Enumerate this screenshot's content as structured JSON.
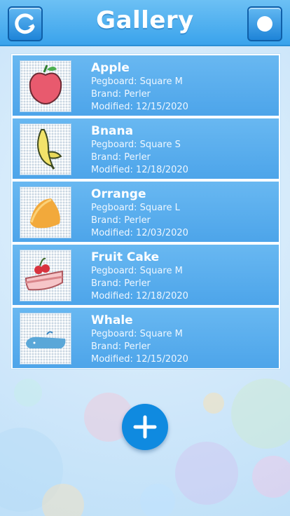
{
  "header": {
    "title": "Gallery",
    "left_icon": "refresh-icon",
    "right_icon": "circle-icon"
  },
  "colors": {
    "header": "#3aa3ec",
    "row": "#4fa9ee",
    "fab": "#0f8ae0"
  },
  "items": [
    {
      "name": "Apple",
      "pegboard": "Pegboard: Square M",
      "brand": "Brand: Perler",
      "modified": "Modified: 12/15/2020",
      "thumbnail": "apple-icon"
    },
    {
      "name": "Bnana",
      "pegboard": "Pegboard: Square S",
      "brand": "Brand: Perler",
      "modified": "Modified: 12/18/2020",
      "thumbnail": "banana-icon"
    },
    {
      "name": "Orrange",
      "pegboard": "Pegboard: Square L",
      "brand": "Brand: Perler",
      "modified": "Modified: 12/03/2020",
      "thumbnail": "orange-icon"
    },
    {
      "name": "Fruit Cake",
      "pegboard": "Pegboard: Square M",
      "brand": "Brand: Perler",
      "modified": "Modified: 12/18/2020",
      "thumbnail": "cake-icon"
    },
    {
      "name": "Whale",
      "pegboard": "Pegboard: Square M",
      "brand": "Brand: Perler",
      "modified": "Modified: 12/15/2020",
      "thumbnail": "whale-icon"
    }
  ],
  "fab": {
    "icon": "plus-icon"
  }
}
